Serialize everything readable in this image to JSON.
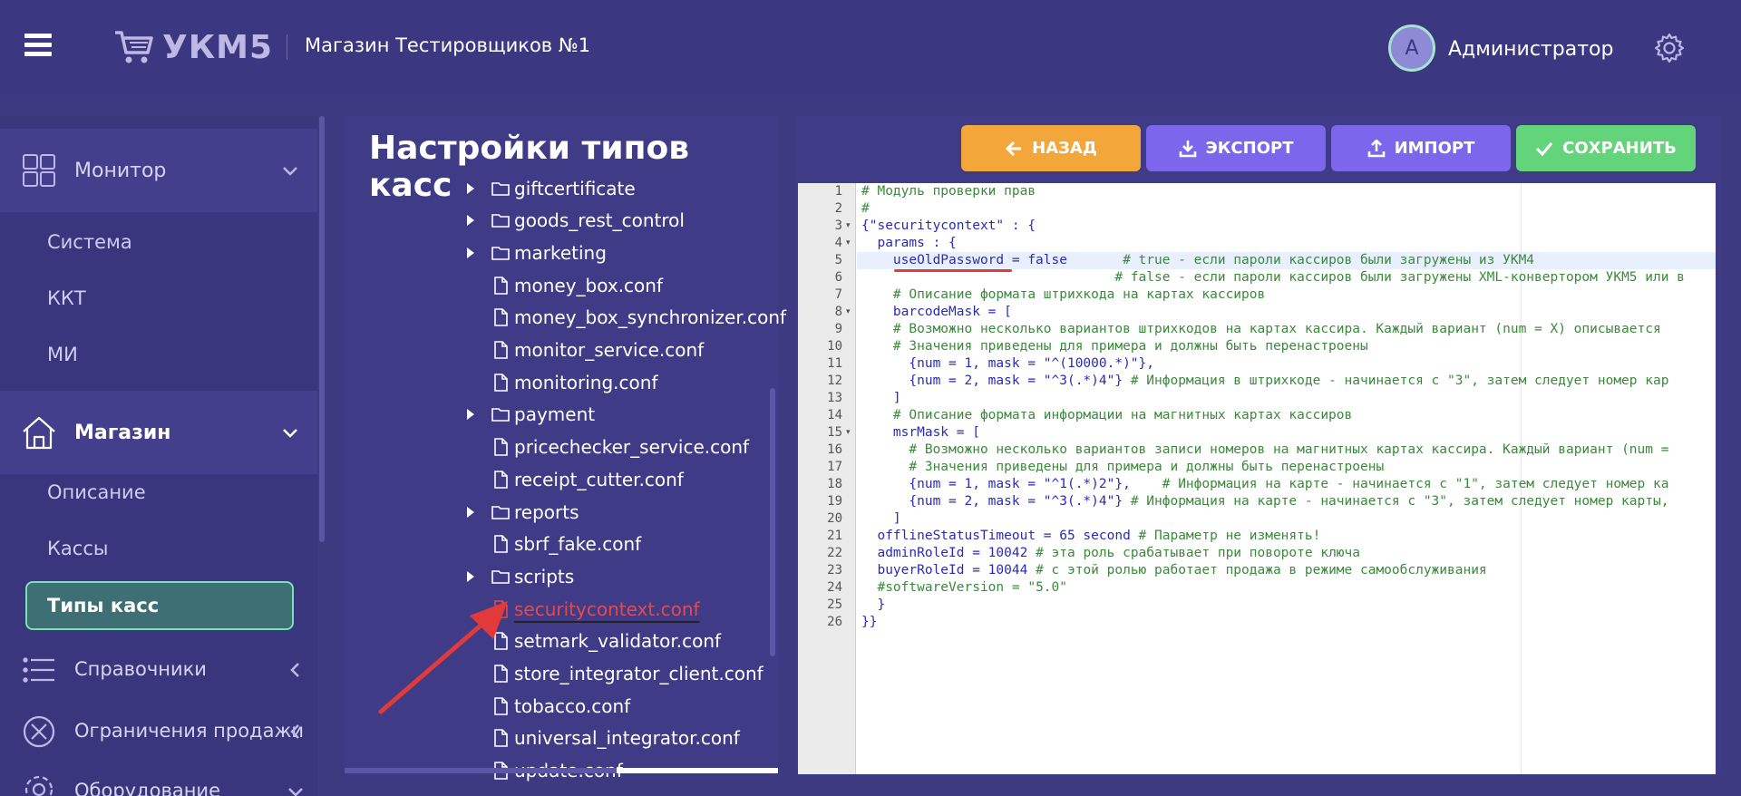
{
  "header": {
    "logo_text": "УКМ5",
    "store_title": "Магазин Тестировщиков №1",
    "avatar_letter": "A",
    "user_name": "Администратор"
  },
  "sidebar": {
    "groups": [
      {
        "label": "Монитор",
        "icon": "dashboard-grid-icon",
        "state": "collapsed"
      },
      {
        "label": "Магазин",
        "icon": "home-icon",
        "state": "expanded"
      }
    ],
    "monitor_items": [
      "Система",
      "ККТ",
      "МИ"
    ],
    "store_items": [
      "Описание",
      "Кассы",
      "Типы касс"
    ],
    "active_item": "Типы касс",
    "bottom_items": [
      {
        "label": "Справочники",
        "icon": "list-icon"
      },
      {
        "label": "Ограничения продажи",
        "icon": "forbidden-icon"
      },
      {
        "label": "Оборудование",
        "icon": "gear-icon"
      }
    ]
  },
  "middle": {
    "title": "Настройки типов касс",
    "tree": [
      {
        "name": "giftcertificate",
        "type": "folder"
      },
      {
        "name": "goods_rest_control",
        "type": "folder"
      },
      {
        "name": "marketing",
        "type": "folder"
      },
      {
        "name": "money_box.conf",
        "type": "file"
      },
      {
        "name": "money_box_synchronizer.conf",
        "type": "file"
      },
      {
        "name": "monitor_service.conf",
        "type": "file"
      },
      {
        "name": "monitoring.conf",
        "type": "file"
      },
      {
        "name": "payment",
        "type": "folder"
      },
      {
        "name": "pricechecker_service.conf",
        "type": "file"
      },
      {
        "name": "receipt_cutter.conf",
        "type": "file"
      },
      {
        "name": "reports",
        "type": "folder"
      },
      {
        "name": "sbrf_fake.conf",
        "type": "file"
      },
      {
        "name": "scripts",
        "type": "folder"
      },
      {
        "name": "securitycontext.conf",
        "type": "file",
        "selected": true
      },
      {
        "name": "setmark_validator.conf",
        "type": "file"
      },
      {
        "name": "store_integrator_client.conf",
        "type": "file"
      },
      {
        "name": "tobacco.conf",
        "type": "file"
      },
      {
        "name": "universal_integrator.conf",
        "type": "file"
      },
      {
        "name": "update.conf",
        "type": "file"
      }
    ]
  },
  "toolbar": {
    "back_label": "НАЗАД",
    "export_label": "ЭКСПОРТ",
    "import_label": "ИМПОРТ",
    "save_label": "СОХРАНИТЬ"
  },
  "editor": {
    "lines": [
      "# Модуль проверки прав",
      "#",
      "{\"securitycontext\" : {",
      "  params : {",
      "    useOldPassword = false       # true - если пароли кассиров были загружены из УКМ4",
      "                                # false - если пароли кассиров были загружены XML-конвертором УКМ5 или в",
      "    # Описание формата штрихкода на картах кассиров",
      "    barcodeMask = [",
      "    # Возможно несколько вариантов штрихкодов на картах кассира. Каждый вариант (num = X) описывается",
      "    # Значения приведены для примера и должны быть перенастроены",
      "      {num = 1, mask = \"^(10000.*)\"},",
      "      {num = 2, mask = \"^3(.*)4\"} # Информация в штрихкоде - начинается с \"3\", затем следует номер кар",
      "    ]",
      "    # Описание формата информации на магнитных картах кассиров",
      "    msrMask = [",
      "      # Возможно несколько вариантов записи номеров на магнитных картах кассира. Каждый вариант (num =",
      "      # Значения приведены для примера и должны быть перенастроены",
      "      {num = 1, mask = \"^1(.*)2\"},    # Информация на карте - начинается с \"1\", затем следует номер ка",
      "      {num = 2, mask = \"^3(.*)4\"} # Информация на карте - начинается с \"3\", затем следует номер карты,",
      "    ]",
      "  offlineStatusTimeout = 65 second # Параметр не изменять!",
      "  adminRoleId = 10042 # эта роль срабатывает при повороте ключа",
      "  buyerRoleId = 10044 # с этой ролью работает продажа в режиме самообслуживания",
      "  #softwareVersion = \"5.0\"",
      "  }",
      "}}"
    ],
    "line_numbers": [
      "1",
      "2",
      "3",
      "4",
      "5",
      "6",
      "7",
      "8",
      "9",
      "10",
      "11",
      "12",
      "13",
      "14",
      "15",
      "16",
      "17",
      "18",
      "19",
      "20",
      "21",
      "22",
      "23",
      "24",
      "25",
      "26"
    ]
  },
  "colors": {
    "background": "#3d3a82",
    "accent_green": "#63d47a",
    "accent_orange": "#f3a73b",
    "accent_purple": "#7c66ec",
    "selected_file": "#e34b4b"
  }
}
